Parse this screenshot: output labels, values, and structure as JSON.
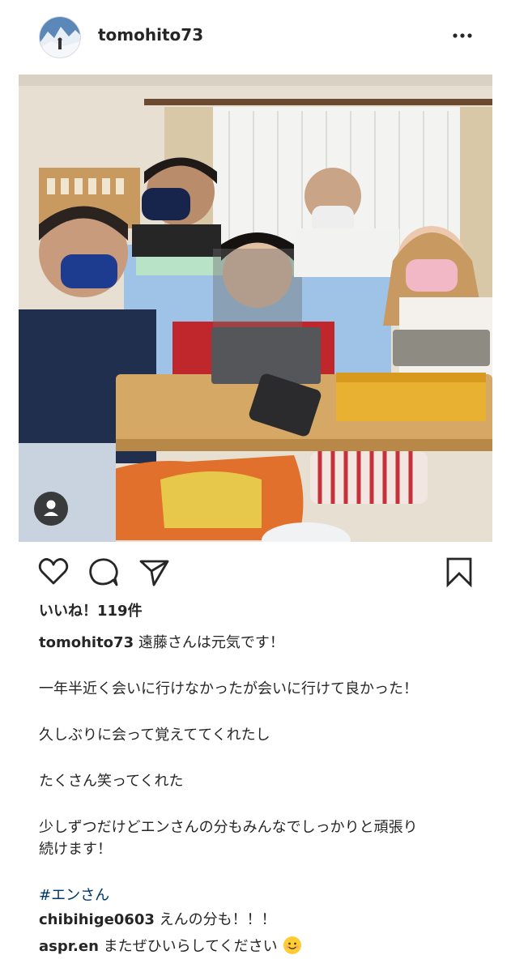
{
  "post": {
    "username": "tomohito73",
    "likes_label": "いいね！119件",
    "caption_user": "tomohito73",
    "caption_lines": [
      "遠藤さんは元気です！",
      "一年半近く会いに行けなかったが会いに行けて良かった！",
      "久しぶりに会って覚えててくれたし",
      "たくさん笑ってくれた",
      "少しずつだけどエンさんの分もみんなでしっかりと頑張り",
      "続けます！"
    ],
    "hashtag": "#エンさん"
  },
  "comments": [
    {
      "user": "chibihige0603",
      "text": "えんの分も！！！"
    },
    {
      "user": "aspr.en",
      "text": "またぜひいらしてください",
      "emoji": "smiling-face-emoji"
    }
  ],
  "icons": {
    "more": "more-options-icon",
    "like": "heart-icon",
    "comment": "comment-icon",
    "share": "share-icon",
    "save": "bookmark-icon",
    "tag": "user-tag-icon"
  },
  "colors": {
    "text": "#262626",
    "hashtag": "#00376b",
    "background": "#ffffff"
  }
}
